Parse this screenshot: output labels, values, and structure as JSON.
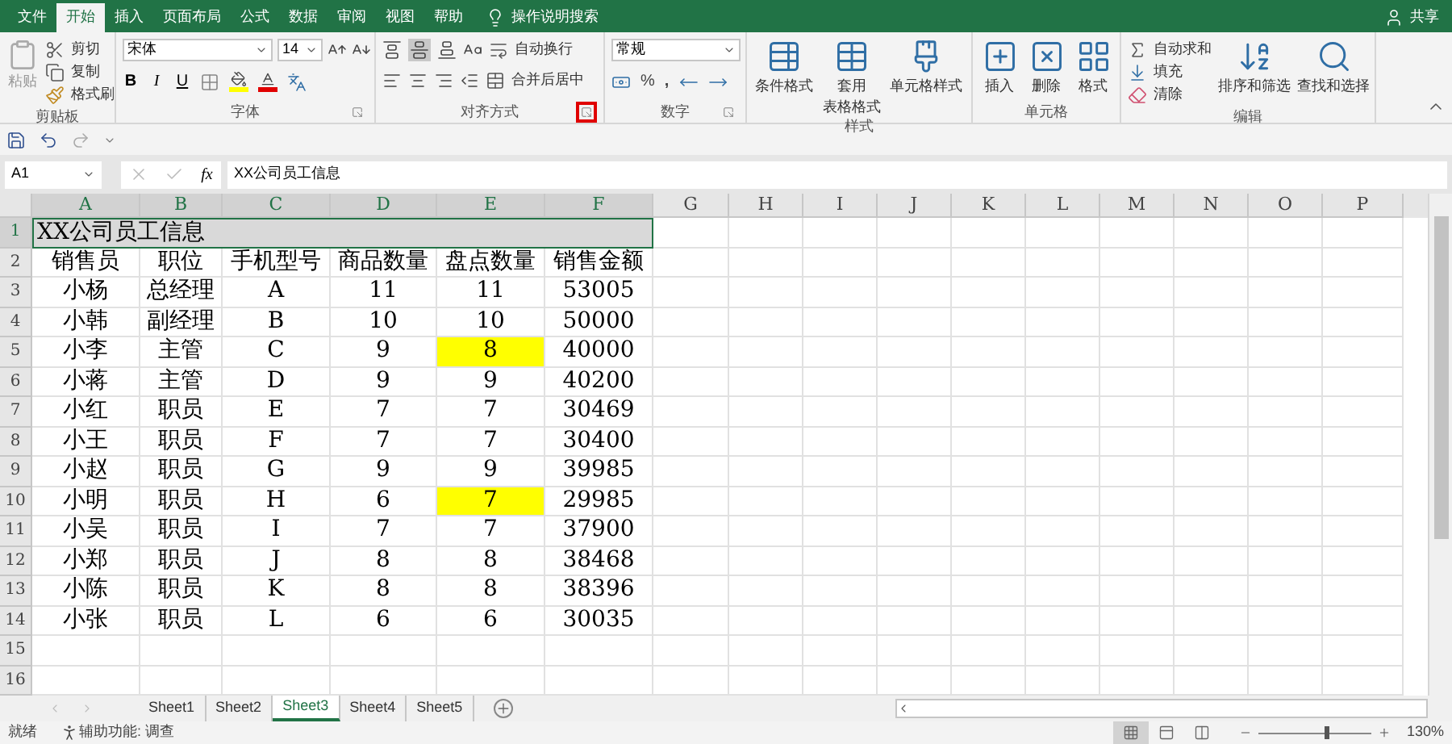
{
  "menu_tabs": [
    {
      "label": "文件",
      "selected": false
    },
    {
      "label": "开始",
      "selected": true
    },
    {
      "label": "插入",
      "selected": false
    },
    {
      "label": "页面布局",
      "selected": false
    },
    {
      "label": "公式",
      "selected": false
    },
    {
      "label": "数据",
      "selected": false
    },
    {
      "label": "审阅",
      "selected": false
    },
    {
      "label": "视图",
      "selected": false
    },
    {
      "label": "帮助",
      "selected": false
    }
  ],
  "tell_me": "操作说明搜索",
  "share": "共享",
  "clipboard": {
    "paste": "粘贴",
    "cut": "剪切",
    "copy": "复制",
    "format_painter": "格式刷",
    "label": "剪贴板"
  },
  "font": {
    "name": "宋体",
    "size": "14",
    "bold": "B",
    "italic": "I",
    "underline": "U",
    "label": "字体"
  },
  "alignment": {
    "wrap": "自动换行",
    "merge": "合并后居中",
    "label": "对齐方式",
    "launcher_marked": true
  },
  "number": {
    "format": "常规",
    "percent": "%",
    "comma": ",",
    "label": "数字"
  },
  "styles": {
    "conditional": "条件格式",
    "table_top": "套用",
    "table_bottom": "表格格式",
    "cell_styles": "单元格样式",
    "label": "样式"
  },
  "cells": {
    "insert": "插入",
    "delete": "删除",
    "format": "格式",
    "label": "单元格"
  },
  "editing": {
    "autosum": "自动求和",
    "fill": "填充",
    "clear": "清除",
    "sort": "排序和筛选",
    "find": "查找和选择",
    "label": "编辑"
  },
  "formula_bar": {
    "name_box": "A1",
    "fx": "fx",
    "formula": "XX公司员工信息"
  },
  "columns": [
    {
      "label": "A",
      "selected": true
    },
    {
      "label": "B",
      "selected": true
    },
    {
      "label": "C",
      "selected": true
    },
    {
      "label": "D",
      "selected": true
    },
    {
      "label": "E",
      "selected": true
    },
    {
      "label": "F",
      "selected": true
    },
    {
      "label": "G",
      "selected": false
    },
    {
      "label": "H",
      "selected": false
    },
    {
      "label": "I",
      "selected": false
    },
    {
      "label": "J",
      "selected": false
    },
    {
      "label": "K",
      "selected": false
    },
    {
      "label": "L",
      "selected": false
    },
    {
      "label": "M",
      "selected": false
    },
    {
      "label": "N",
      "selected": false
    },
    {
      "label": "O",
      "selected": false
    },
    {
      "label": "P",
      "selected": false
    }
  ],
  "rows": [
    {
      "number": "1",
      "selected": true,
      "title": "XX公司员工信息",
      "cells": []
    },
    {
      "number": "2",
      "selected": false,
      "cells": [
        "销售员",
        "职位",
        "手机型号",
        "商品数量",
        "盘点数量",
        "销售金额"
      ]
    },
    {
      "number": "3",
      "selected": false,
      "cells": [
        "小杨",
        "总经理",
        "A",
        "11",
        "11",
        "53005"
      ]
    },
    {
      "number": "4",
      "selected": false,
      "cells": [
        "小韩",
        "副经理",
        "B",
        "10",
        "10",
        "50000"
      ]
    },
    {
      "number": "5",
      "selected": false,
      "cells": [
        "小李",
        "主管",
        "C",
        "9",
        {
          "text": "8",
          "color": "#ffff00"
        },
        "40000"
      ]
    },
    {
      "number": "6",
      "selected": false,
      "cells": [
        "小蒋",
        "主管",
        "D",
        "9",
        "9",
        "40200"
      ]
    },
    {
      "number": "7",
      "selected": false,
      "cells": [
        "小红",
        "职员",
        "E",
        "7",
        "7",
        "30469"
      ]
    },
    {
      "number": "8",
      "selected": false,
      "cells": [
        "小王",
        "职员",
        "F",
        "7",
        "7",
        "30400"
      ]
    },
    {
      "number": "9",
      "selected": false,
      "cells": [
        "小赵",
        "职员",
        "G",
        "9",
        "9",
        "39985"
      ]
    },
    {
      "number": "10",
      "selected": false,
      "cells": [
        "小明",
        "职员",
        "H",
        "6",
        {
          "text": "7",
          "color": "#ffff00"
        },
        "29985"
      ]
    },
    {
      "number": "11",
      "selected": false,
      "cells": [
        "小吴",
        "职员",
        "I",
        "7",
        "7",
        "37900"
      ]
    },
    {
      "number": "12",
      "selected": false,
      "cells": [
        "小郑",
        "职员",
        "J",
        "8",
        "8",
        "38468"
      ]
    },
    {
      "number": "13",
      "selected": false,
      "cells": [
        "小陈",
        "职员",
        "K",
        "8",
        "8",
        "38396"
      ]
    },
    {
      "number": "14",
      "selected": false,
      "cells": [
        "小张",
        "职员",
        "L",
        "6",
        "6",
        "30035"
      ]
    },
    {
      "number": "15",
      "selected": false,
      "cells": []
    },
    {
      "number": "16",
      "selected": false,
      "cells": []
    }
  ],
  "sheets": [
    {
      "label": "Sheet1",
      "selected": false
    },
    {
      "label": "Sheet2",
      "selected": false
    },
    {
      "label": "Sheet3",
      "selected": true
    },
    {
      "label": "Sheet4",
      "selected": false
    },
    {
      "label": "Sheet5",
      "selected": false
    }
  ],
  "status": {
    "ready": "就绪",
    "accessibility": "辅助功能: 调查",
    "zoom": "130%",
    "zoom_slider": {
      "level": 0.6
    },
    "views": [
      {
        "kind": "normal",
        "selected": true
      },
      {
        "kind": "layout",
        "selected": false
      },
      {
        "kind": "pagebreak",
        "selected": false
      }
    ]
  }
}
